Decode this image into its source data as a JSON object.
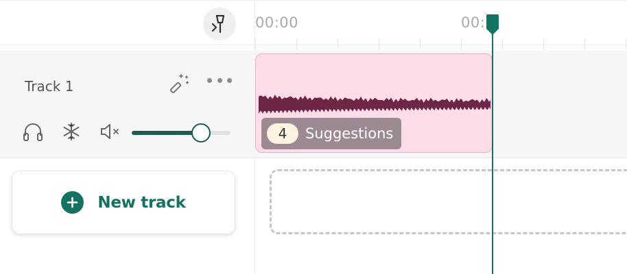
{
  "ruler": {
    "labels": [
      "00:00",
      "00:"
    ]
  },
  "track": {
    "name": "Track 1",
    "volume_percent": 70,
    "clip": {
      "suggestions_count": "4",
      "suggestions_label": "Suggestions",
      "color": "#fcdde8",
      "waveform_color": "#6e2646"
    }
  },
  "new_track": {
    "label": "New track"
  },
  "colors": {
    "accent": "#137262",
    "playhead": "#127564"
  },
  "icons": {
    "snap": "snap-icon",
    "magic": "magic-wand-icon",
    "more": "more-icon",
    "headphones": "headphones-icon",
    "freeze": "snowflake-icon",
    "mute": "speaker-mute-icon",
    "add": "plus-icon"
  }
}
